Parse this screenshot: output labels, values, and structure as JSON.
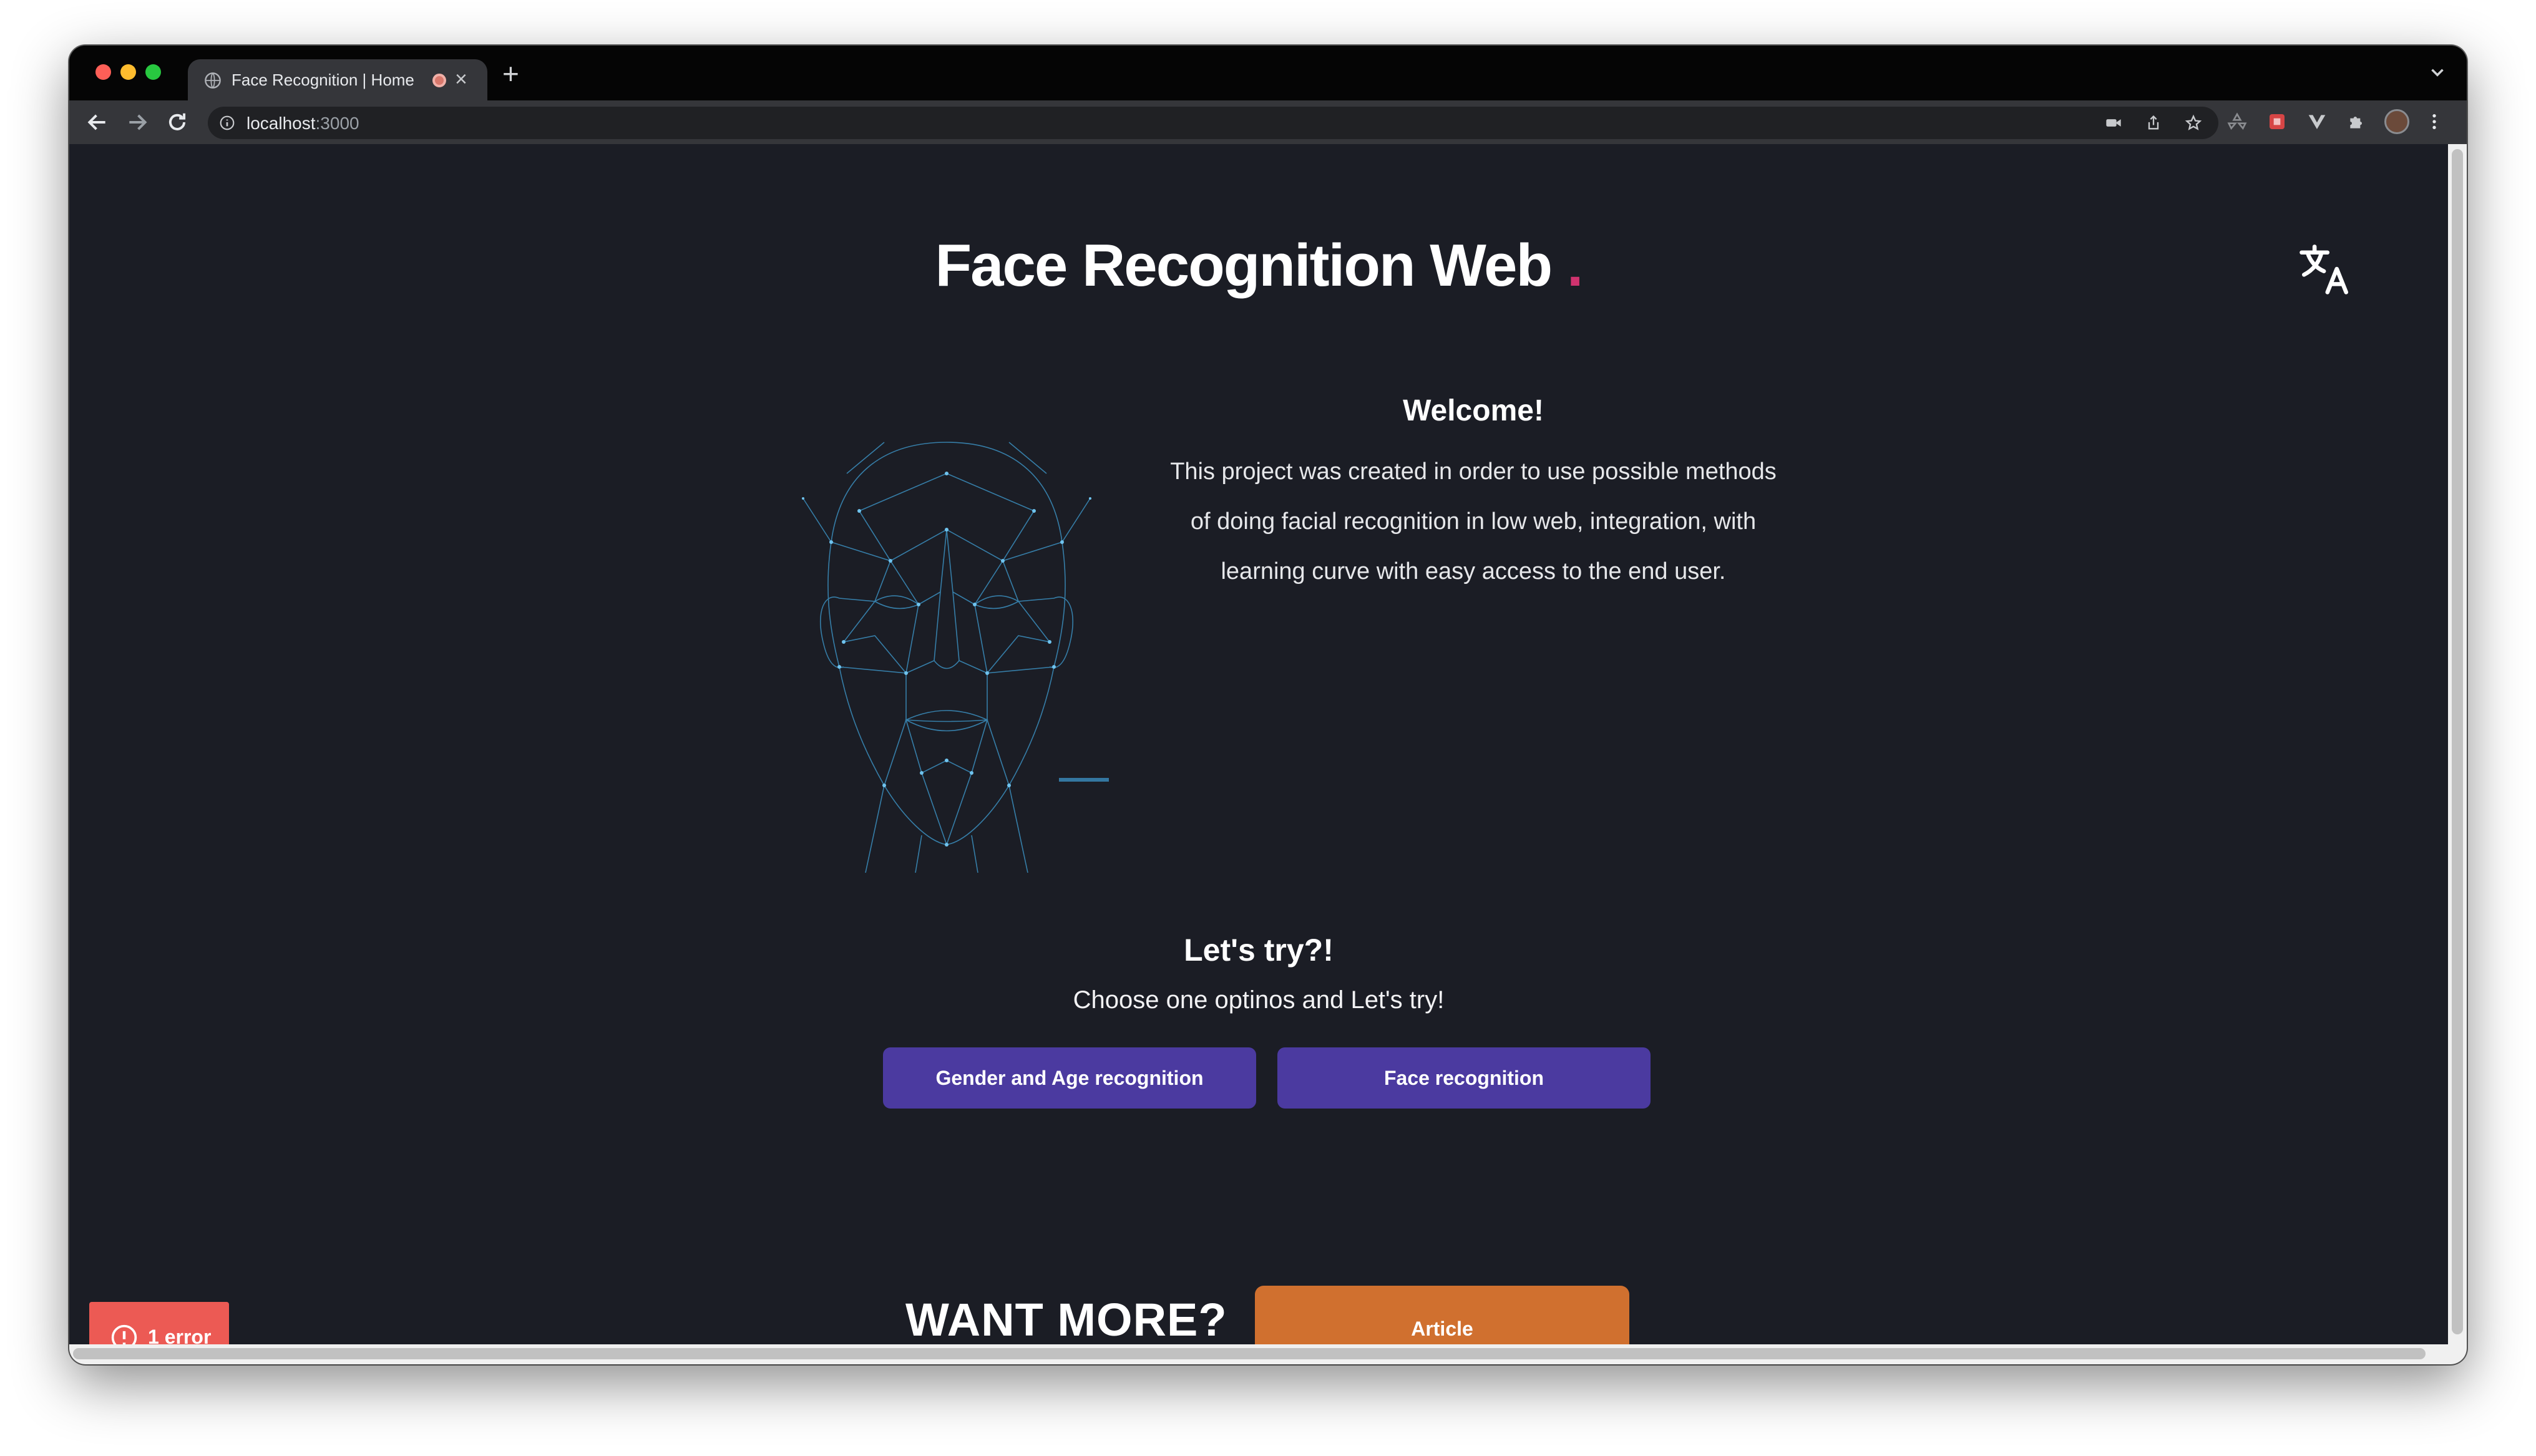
{
  "browser": {
    "tab_title": "Face Recognition | Home",
    "new_tab_label": "+",
    "close_tab_label": "×",
    "url_host": "localhost",
    "url_port": ":3000"
  },
  "page": {
    "title": "Face Recognition Web",
    "title_accent": ".",
    "accent_color": "#d0336f",
    "background_color": "#1b1d25"
  },
  "welcome": {
    "heading": "Welcome!",
    "text": "This project was created in order to use possible methods of doing facial recognition in low web, integration, with learning curve with easy access to the end user."
  },
  "try_section": {
    "heading": "Let's try?!",
    "subtitle": "Choose one optinos and Let's try!",
    "buttons": [
      {
        "label": "Gender and Age recognition",
        "color": "#4b3aa0"
      },
      {
        "label": "Face recognition",
        "color": "#4b3aa0"
      }
    ]
  },
  "more": {
    "heading": "WANT MORE?",
    "button_label": "Article",
    "button_color": "#d0702f"
  },
  "error_badge": {
    "label": "1 error",
    "color": "#ec5a54"
  },
  "icons": {
    "translate": "translate-icon",
    "face": "face-mesh-illustration",
    "error": "alert-circle-icon"
  }
}
